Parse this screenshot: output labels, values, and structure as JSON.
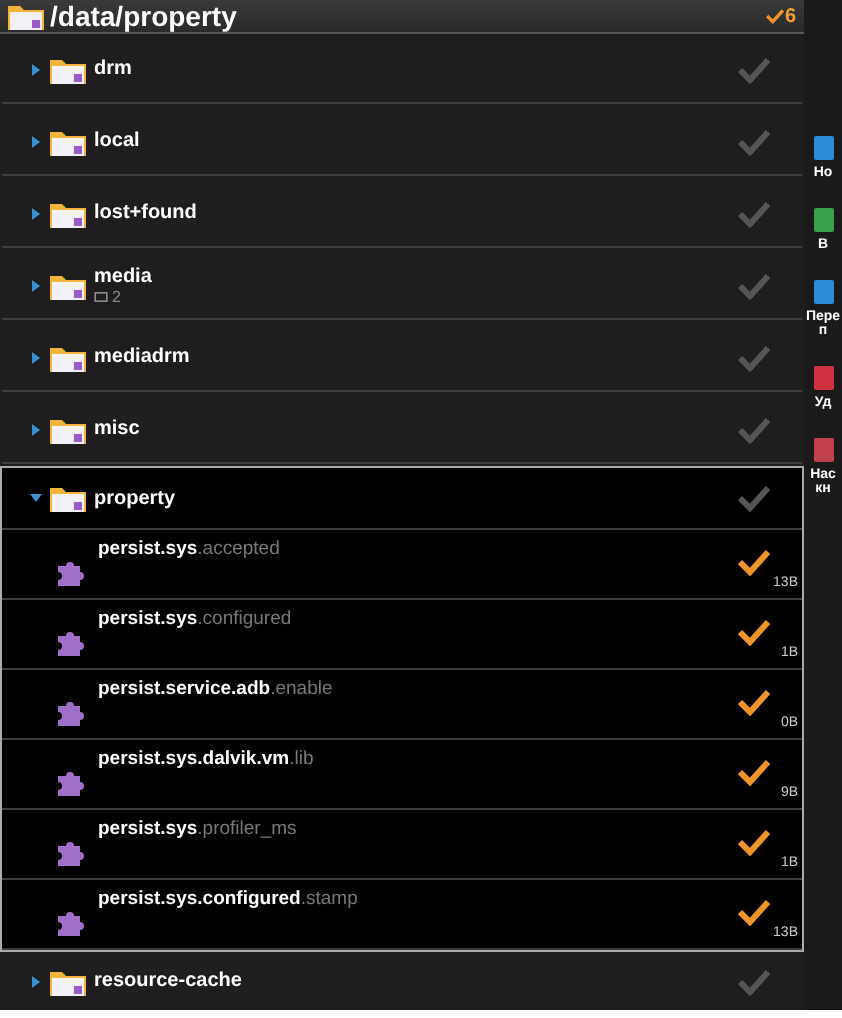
{
  "header": {
    "path": "/data/property",
    "checked_count": "6"
  },
  "items": [
    {
      "name": "drm",
      "kind": "folder",
      "selected": false,
      "checked": false
    },
    {
      "name": "local",
      "kind": "folder",
      "selected": false,
      "checked": false
    },
    {
      "name": "lost+found",
      "kind": "folder",
      "selected": false,
      "checked": false
    },
    {
      "name": "media",
      "kind": "folder",
      "selected": false,
      "checked": false,
      "subcount": "2"
    },
    {
      "name": "mediadrm",
      "kind": "folder",
      "selected": false,
      "checked": false
    },
    {
      "name": "misc",
      "kind": "folder",
      "selected": false,
      "checked": false
    },
    {
      "name": "property",
      "kind": "folder",
      "selected": true,
      "checked": false,
      "expanded": true,
      "children": [
        {
          "name": "persist.sys",
          "ext": ".accepted",
          "kind": "file",
          "checked": true,
          "size": "13B"
        },
        {
          "name": "persist.sys",
          "ext": ".configured",
          "kind": "file",
          "checked": true,
          "size": "1B"
        },
        {
          "name": "persist.service.adb",
          "ext": ".enable",
          "kind": "file",
          "checked": true,
          "size": "0B"
        },
        {
          "name": "persist.sys.dalvik.vm",
          "ext": ".lib",
          "kind": "file",
          "checked": true,
          "size": "9B"
        },
        {
          "name": "persist.sys",
          "ext": ".profiler_ms",
          "kind": "file",
          "checked": true,
          "size": "1B"
        },
        {
          "name": "persist.sys.configured",
          "ext": ".stamp",
          "kind": "file",
          "checked": true,
          "size": "13B"
        }
      ]
    },
    {
      "name": "resource-cache",
      "kind": "folder",
      "selected": false,
      "checked": false
    }
  ],
  "side_actions": [
    {
      "lines": [
        "Но"
      ],
      "color": "#2a8fd8"
    },
    {
      "lines": [
        "В"
      ],
      "color": "#3aa04a"
    },
    {
      "lines": [
        "Пере",
        "п"
      ],
      "color": "#2a8fd8"
    },
    {
      "lines": [
        "Уд"
      ],
      "color": "#d03040"
    },
    {
      "lines": [
        "Нас",
        "кн"
      ],
      "color": "#c04050"
    }
  ]
}
